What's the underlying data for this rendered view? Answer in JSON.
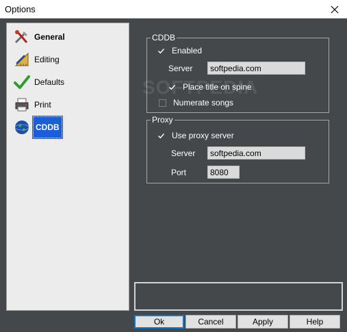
{
  "window": {
    "title": "Options",
    "close_icon": "close-icon"
  },
  "nav": {
    "items": [
      {
        "label": "General",
        "icon": "tools-icon"
      },
      {
        "label": "Editing",
        "icon": "ruler-pencil-icon"
      },
      {
        "label": "Defaults",
        "icon": "checkmark-icon"
      },
      {
        "label": "Print",
        "icon": "printer-icon"
      },
      {
        "label": "CDDB",
        "icon": "globe-icon",
        "selected": true
      }
    ]
  },
  "cddb": {
    "legend": "CDDB",
    "enabled": {
      "label": "Enabled",
      "checked": true
    },
    "server_label": "Server",
    "server_value": "softpedia.com",
    "place_title": {
      "label": "Place title on spine",
      "checked": true
    },
    "numerate": {
      "label": "Numerate songs",
      "checked": false
    }
  },
  "proxy": {
    "legend": "Proxy",
    "use_proxy": {
      "label": "Use proxy server",
      "checked": true
    },
    "server_label": "Server",
    "server_value": "softpedia.com",
    "port_label": "Port",
    "port_value": "8080"
  },
  "watermark": "SOFTPEDIA",
  "buttons": {
    "ok": "Ok",
    "cancel": "Cancel",
    "apply": "Apply",
    "help": "Help"
  },
  "colors": {
    "background": "#45484b",
    "selection": "#1a5fd8",
    "default_button_border": "#0078d7"
  }
}
